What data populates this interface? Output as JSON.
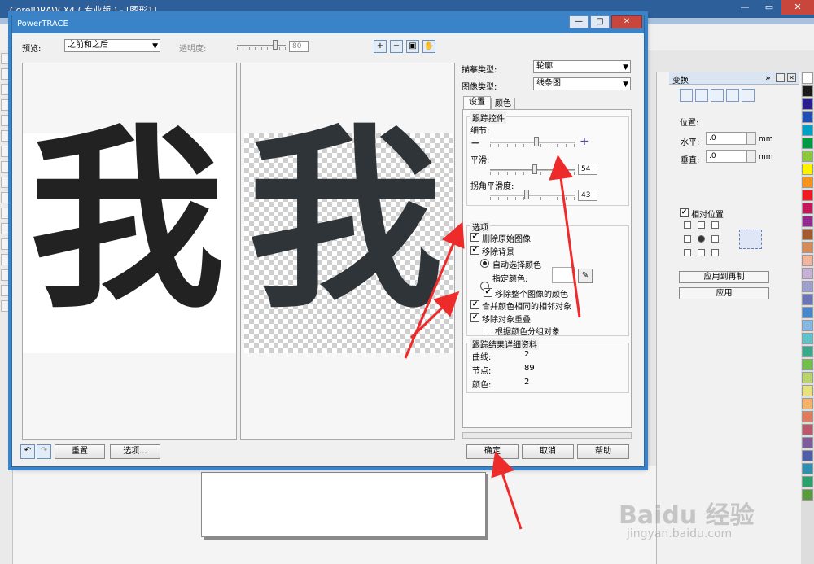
{
  "app": {
    "title": "CorelDRAW X4 ( 专业版 ) - [图形1]"
  },
  "dialog": {
    "title": "PowerTRACE",
    "preview": {
      "label": "预览:",
      "value": "之前和之后"
    },
    "transparency": {
      "label": "透明度:",
      "value": "80"
    },
    "before_char": "我",
    "after_char": "我",
    "trace_type": {
      "label": "描摹类型:",
      "value": "轮廓"
    },
    "image_type": {
      "label": "图像类型:",
      "value": "线条图"
    },
    "tabs": [
      "设置",
      "颜色"
    ],
    "trace_controls": {
      "title": "跟踪控件",
      "detail_label": "细节:",
      "smooth_label": "平滑:",
      "smooth_value": "54",
      "corner_label": "拐角平滑度:",
      "corner_value": "43"
    },
    "options": {
      "title": "选项",
      "delete_original": "删除原始图像",
      "remove_background": "移除背景",
      "auto_color": "自动选择颜色",
      "specify_color": "指定颜色:",
      "remove_whole_color": "移除整个图像的颜色",
      "merge_adjacent": "合并颜色相同的相邻对象",
      "remove_overlap": "移除对象重叠",
      "group_by_color": "根据颜色分组对象"
    },
    "results": {
      "title": "跟踪结果详细资料",
      "rows": [
        {
          "label": "曲线:",
          "value": "2"
        },
        {
          "label": "节点:",
          "value": "89"
        },
        {
          "label": "颜色:",
          "value": "2"
        }
      ]
    },
    "buttons": {
      "reset": "重置",
      "options": "选项...",
      "ok": "确定",
      "cancel": "取消",
      "help": "帮助"
    }
  },
  "transform_panel": {
    "title": "变换",
    "position_label": "位置:",
    "h_label": "水平:",
    "h_value": ".0",
    "v_label": "垂直:",
    "v_value": ".0",
    "unit": "mm",
    "relative_label": "相对位置",
    "apply_duplicate": "应用到再制",
    "apply": "应用"
  },
  "palette_colors": [
    "#ffffff",
    "#1a1a1a",
    "#2b1f8f",
    "#1f4fb5",
    "#00a0c6",
    "#009a44",
    "#8dc63f",
    "#fff200",
    "#f7941d",
    "#ed1c24",
    "#c2185b",
    "#92278f",
    "#a05a2c",
    "#d58a5a",
    "#f2b6a0",
    "#c7b2d6",
    "#9e9fcb",
    "#6b75b3",
    "#4a86c5",
    "#88b7df",
    "#5ec2c8",
    "#3aa88b",
    "#6fbf4a",
    "#b8d46a",
    "#e6e27c",
    "#f6b26b",
    "#e07b5c",
    "#b85a6b",
    "#7f5b9a",
    "#505fa8",
    "#2f8fb0",
    "#2aa06a",
    "#5a9a3e"
  ],
  "watermark": {
    "main": "Baidu 经验",
    "sub": "jingyan.baidu.com"
  }
}
